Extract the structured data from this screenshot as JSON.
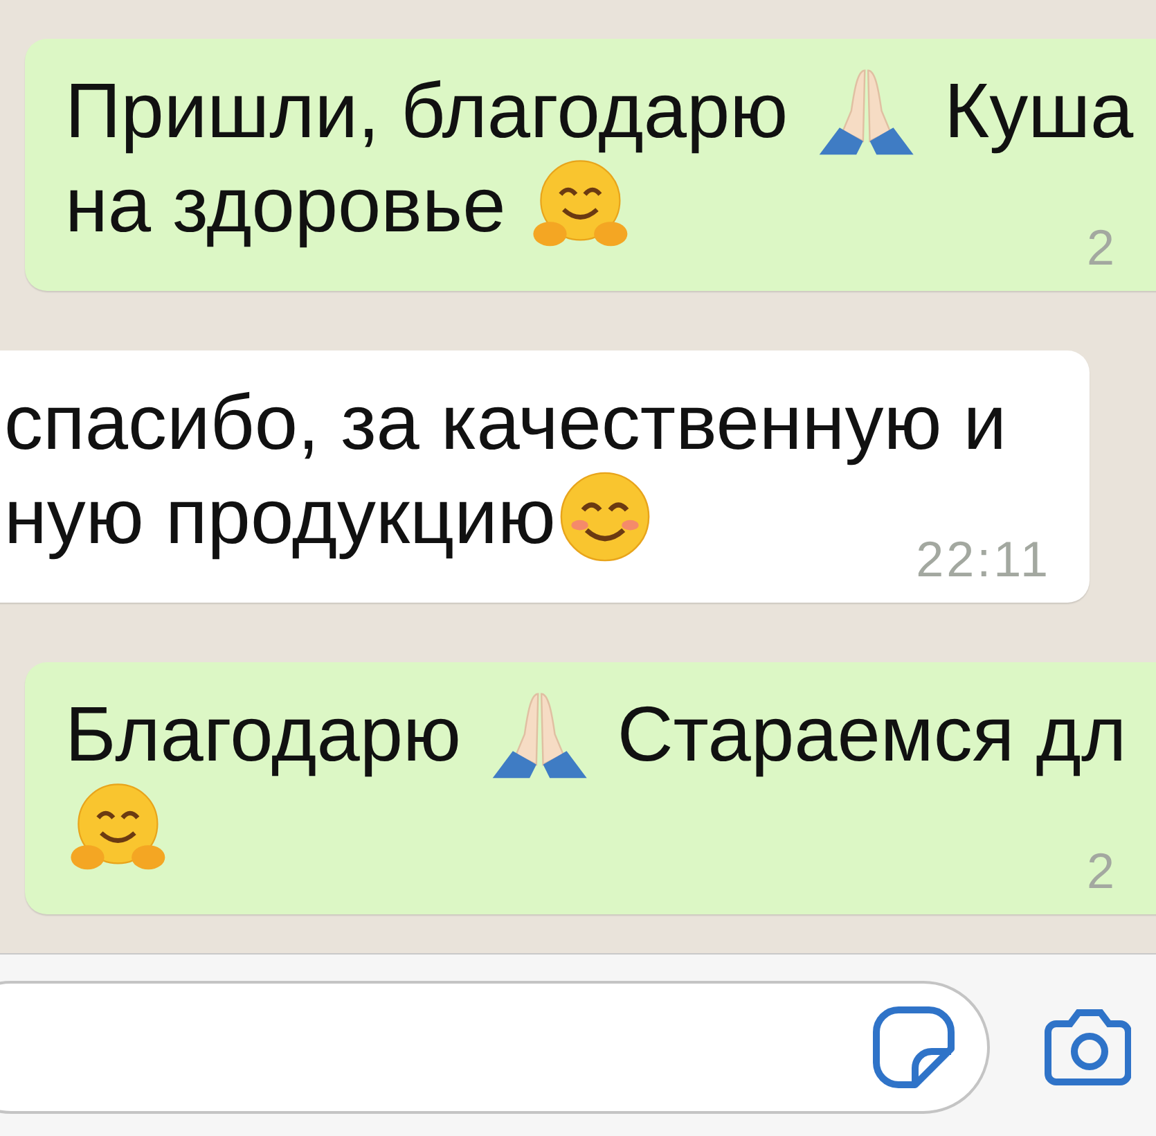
{
  "messages": [
    {
      "kind": "outgoing",
      "lines": [
        [
          {
            "kind": "text",
            "text": "Пришли, благодарю "
          },
          {
            "kind": "pray"
          },
          {
            "kind": "text",
            "text": " Куша"
          }
        ],
        [
          {
            "kind": "text",
            "text": "на здоровье "
          },
          {
            "kind": "hug"
          }
        ]
      ],
      "time": "2"
    },
    {
      "kind": "incoming",
      "lines": [
        [
          {
            "kind": "text",
            "text": "спасибо, за качественную и"
          }
        ],
        [
          {
            "kind": "text",
            "text": "ную продукцию"
          },
          {
            "kind": "smile"
          }
        ]
      ],
      "time": "22:11"
    },
    {
      "kind": "outgoing",
      "lines": [
        [
          {
            "kind": "text",
            "text": "Благодарю "
          },
          {
            "kind": "pray"
          },
          {
            "kind": "text",
            "text": " Стараемся дл"
          }
        ],
        [
          {
            "kind": "hug"
          }
        ]
      ],
      "time": "2"
    }
  ]
}
